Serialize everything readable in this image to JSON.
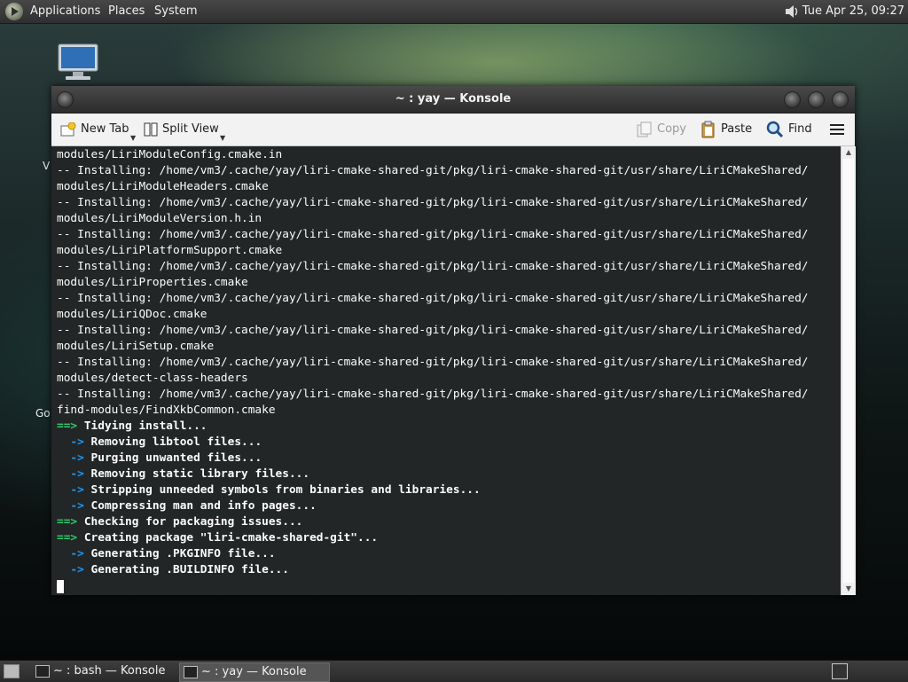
{
  "top_panel": {
    "menus": [
      "Applications",
      "Places",
      "System"
    ],
    "clock": "Tue Apr 25, 09:27"
  },
  "desktop": {
    "partial_labels": [
      "V",
      "Go"
    ]
  },
  "window": {
    "title": "~ : yay — Konsole",
    "toolbar": {
      "new_tab": "New Tab",
      "split_view": "Split View",
      "copy": "Copy",
      "paste": "Paste",
      "find": "Find"
    }
  },
  "terminal": {
    "lines": [
      {
        "text": "modules/LiriModuleConfig.cmake.in",
        "style": "plain"
      },
      {
        "text": "-- Installing: /home/vm3/.cache/yay/liri-cmake-shared-git/pkg/liri-cmake-shared-git/usr/share/LiriCMakeShared/",
        "style": "plain"
      },
      {
        "text": "modules/LiriModuleHeaders.cmake",
        "style": "plain"
      },
      {
        "text": "-- Installing: /home/vm3/.cache/yay/liri-cmake-shared-git/pkg/liri-cmake-shared-git/usr/share/LiriCMakeShared/",
        "style": "plain"
      },
      {
        "text": "modules/LiriModuleVersion.h.in",
        "style": "plain"
      },
      {
        "text": "-- Installing: /home/vm3/.cache/yay/liri-cmake-shared-git/pkg/liri-cmake-shared-git/usr/share/LiriCMakeShared/",
        "style": "plain"
      },
      {
        "text": "modules/LiriPlatformSupport.cmake",
        "style": "plain"
      },
      {
        "text": "-- Installing: /home/vm3/.cache/yay/liri-cmake-shared-git/pkg/liri-cmake-shared-git/usr/share/LiriCMakeShared/",
        "style": "plain"
      },
      {
        "text": "modules/LiriProperties.cmake",
        "style": "plain"
      },
      {
        "text": "-- Installing: /home/vm3/.cache/yay/liri-cmake-shared-git/pkg/liri-cmake-shared-git/usr/share/LiriCMakeShared/",
        "style": "plain"
      },
      {
        "text": "modules/LiriQDoc.cmake",
        "style": "plain"
      },
      {
        "text": "-- Installing: /home/vm3/.cache/yay/liri-cmake-shared-git/pkg/liri-cmake-shared-git/usr/share/LiriCMakeShared/",
        "style": "plain"
      },
      {
        "text": "modules/LiriSetup.cmake",
        "style": "plain"
      },
      {
        "text": "-- Installing: /home/vm3/.cache/yay/liri-cmake-shared-git/pkg/liri-cmake-shared-git/usr/share/LiriCMakeShared/",
        "style": "plain"
      },
      {
        "text": "modules/detect-class-headers",
        "style": "plain"
      },
      {
        "text": "-- Installing: /home/vm3/.cache/yay/liri-cmake-shared-git/pkg/liri-cmake-shared-git/usr/share/LiriCMakeShared/",
        "style": "plain"
      },
      {
        "text": "find-modules/FindXkbCommon.cmake",
        "style": "plain"
      },
      {
        "prefix": "==>",
        "text": " Tidying install...",
        "style": "major"
      },
      {
        "prefix": "  ->",
        "text": " Removing libtool files...",
        "style": "minor"
      },
      {
        "prefix": "  ->",
        "text": " Purging unwanted files...",
        "style": "minor"
      },
      {
        "prefix": "  ->",
        "text": " Removing static library files...",
        "style": "minor"
      },
      {
        "prefix": "  ->",
        "text": " Stripping unneeded symbols from binaries and libraries...",
        "style": "minor"
      },
      {
        "prefix": "  ->",
        "text": " Compressing man and info pages...",
        "style": "minor"
      },
      {
        "prefix": "==>",
        "text": " Checking for packaging issues...",
        "style": "major"
      },
      {
        "prefix": "==>",
        "text": " Creating package \"liri-cmake-shared-git\"...",
        "style": "major"
      },
      {
        "prefix": "  ->",
        "text": " Generating .PKGINFO file...",
        "style": "minor"
      },
      {
        "prefix": "  ->",
        "text": " Generating .BUILDINFO file...",
        "style": "minor"
      }
    ]
  },
  "taskbar": {
    "tasks": [
      "~ : bash — Konsole",
      "~ : yay — Konsole"
    ],
    "active_index": 1
  },
  "colors": {
    "terminal_bg": "#232627",
    "arrow_major": "#2ecc71",
    "arrow_minor": "#1d99f3",
    "text": "#fcfcfc"
  }
}
